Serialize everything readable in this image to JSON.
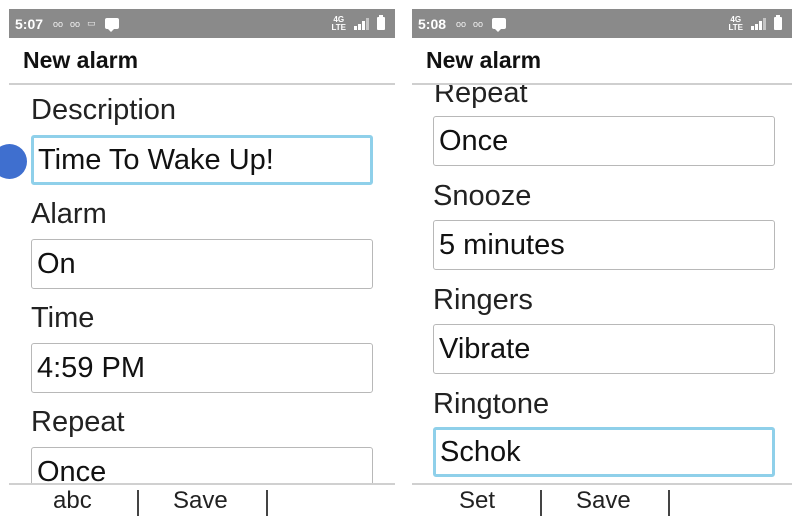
{
  "left": {
    "status": {
      "time": "5:07",
      "lte": "4G"
    },
    "title": "New alarm",
    "labels": {
      "description": "Description",
      "alarm": "Alarm",
      "time": "Time",
      "repeat": "Repeat"
    },
    "values": {
      "description": "Time To Wake Up!",
      "alarm": "On",
      "time": "4:59 PM",
      "repeat": "Once"
    },
    "softkeys": {
      "left": "abc",
      "center": "Save"
    }
  },
  "right": {
    "status": {
      "time": "5:08",
      "lte": "4G"
    },
    "title": "New alarm",
    "labels": {
      "repeat": "Repeat",
      "snooze": "Snooze",
      "ringers": "Ringers",
      "ringtone": "Ringtone"
    },
    "values": {
      "repeat": "Once",
      "snooze": "5 minutes",
      "ringers": "Vibrate",
      "ringtone": "Schok"
    },
    "softkeys": {
      "left": "Set",
      "center": "Save"
    }
  },
  "colors": {
    "status_bar": "#8a8a8a",
    "focus_border": "#8fd0ea",
    "cursor_dot": "#3f6fcf"
  }
}
